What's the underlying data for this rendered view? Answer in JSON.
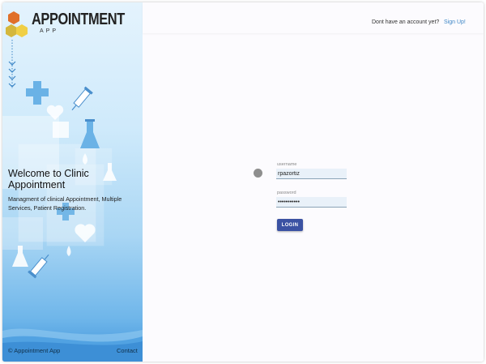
{
  "brand": {
    "title": "APPOINTMENT",
    "subtitle": "APP",
    "logo_colors": [
      "#e0702a",
      "#d4b73c",
      "#f0cf45"
    ]
  },
  "welcome": {
    "title": "Welcome to Clinic Appointment",
    "description": "Managment of clinical Appointment, Multiple Services, Patient Registration."
  },
  "footer": {
    "copyright": "© Appointment App",
    "contact": "Contact"
  },
  "header": {
    "account_prompt": "Dont have an account yet?",
    "signup_label": "Sign Up!"
  },
  "login_form": {
    "username_label": "username",
    "username_value": "rpazortiz",
    "password_label": "password",
    "password_value": "rpazortiz12",
    "submit_label": "LOGIN"
  },
  "icons": [
    "chevron-down-icon",
    "medical-cross-icon",
    "heart-icon",
    "syringe-icon",
    "flask-icon",
    "drop-icon"
  ],
  "colors": {
    "accent": "#3b52a3",
    "link": "#3d86c6",
    "panel_gradient_top": "#e4f3fd",
    "panel_gradient_bottom": "#3f93db"
  }
}
